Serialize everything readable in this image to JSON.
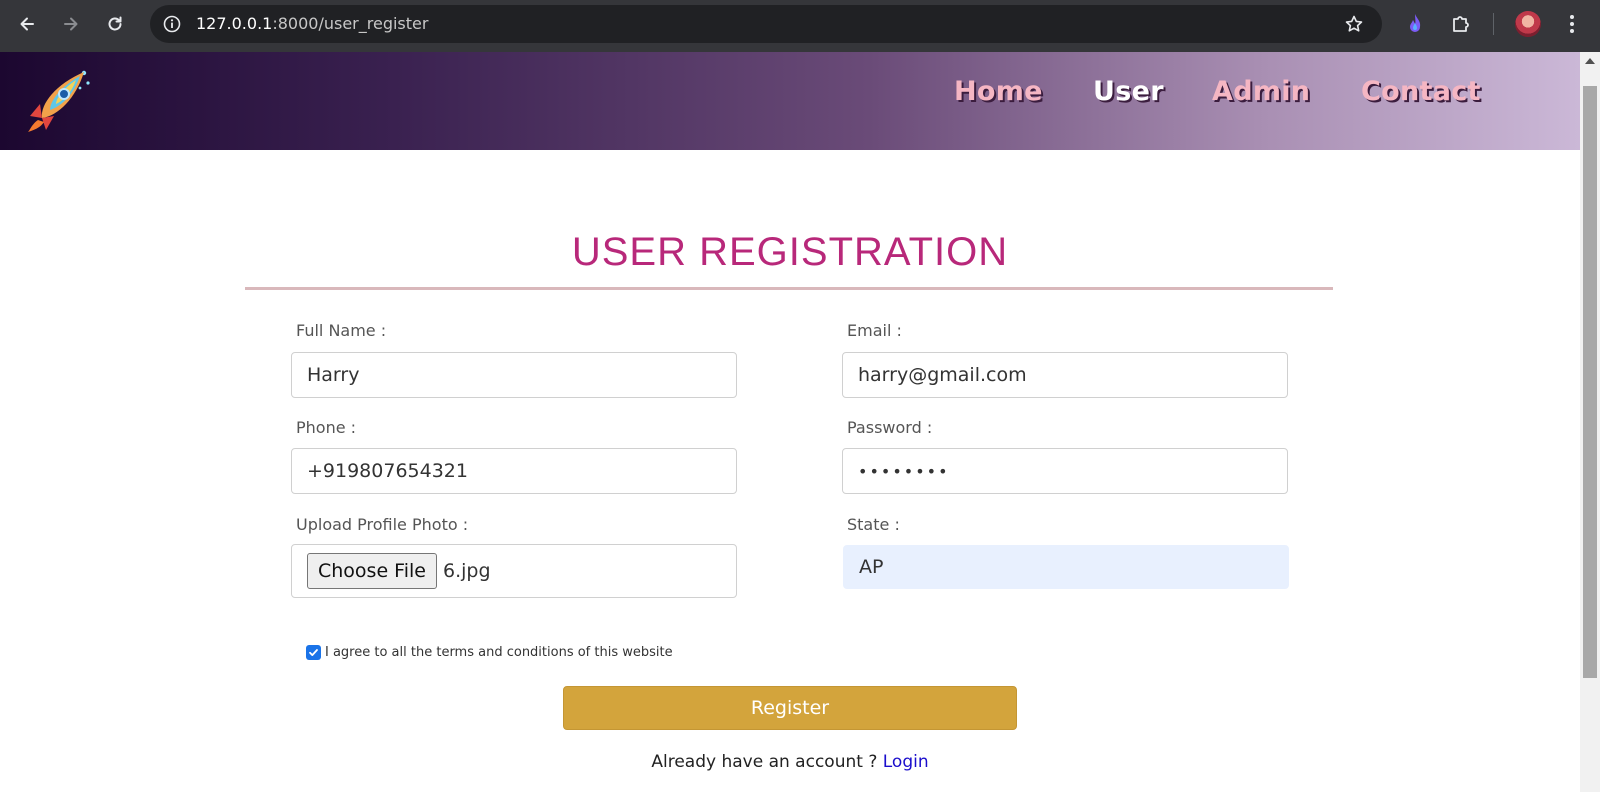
{
  "browser": {
    "url_host": "127.0.0.1",
    "url_rest": ":8000/user_register"
  },
  "nav": {
    "items": [
      {
        "label": "Home"
      },
      {
        "label": "User"
      },
      {
        "label": "Admin"
      },
      {
        "label": "Contact"
      }
    ]
  },
  "form": {
    "title": "USER REGISTRATION",
    "full_name_label": "Full Name :",
    "full_name_value": "Harry",
    "email_label": "Email :",
    "email_value": "harry@gmail.com",
    "phone_label": "Phone :",
    "phone_value": "+919807654321",
    "password_label": "Password :",
    "password_value": "••••••••",
    "photo_label": "Upload Profile Photo :",
    "choose_file_label": "Choose File",
    "file_name": "6.jpg",
    "state_label": "State :",
    "state_value": "AP",
    "terms_text": "I agree to all the terms and conditions of this website",
    "terms_checked": true,
    "register_label": "Register",
    "account_text": "Already have an account ?",
    "login_label": "Login"
  },
  "colors": {
    "title": "#b8287a",
    "register_button": "#d3a43c",
    "nav_link": "#f5b6c3",
    "nav_active": "#ffffff"
  }
}
